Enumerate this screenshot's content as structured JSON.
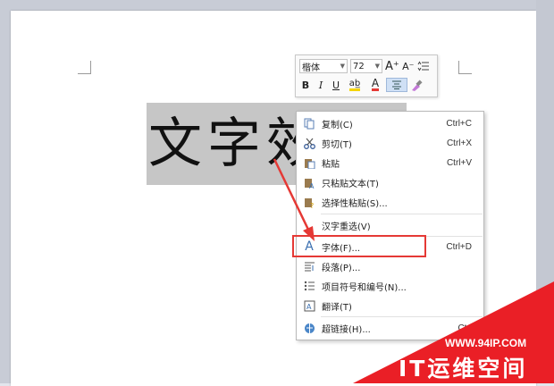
{
  "document": {
    "selected_text": "文字效果"
  },
  "mini_toolbar": {
    "font_name": "楷体",
    "font_size": "72",
    "grow_font": "A⁺",
    "shrink_font": "A⁻",
    "bold": "B",
    "italic": "I",
    "underline": "U",
    "highlight": "ab̲",
    "font_color": "A"
  },
  "context_menu": {
    "items": [
      {
        "label": "复制(C)",
        "shortcut": "Ctrl+C",
        "icon": "copy-icon"
      },
      {
        "label": "剪切(T)",
        "shortcut": "Ctrl+X",
        "icon": "scissors-icon"
      },
      {
        "label": "粘贴",
        "shortcut": "Ctrl+V",
        "icon": "paste-icon"
      },
      {
        "label": "只粘贴文本(T)",
        "shortcut": "",
        "icon": "paste-text-icon"
      },
      {
        "label": "选择性粘贴(S)...",
        "shortcut": "",
        "icon": "paste-special-icon"
      },
      {
        "label": "汉字重选(V)",
        "shortcut": "",
        "icon": ""
      },
      {
        "label": "字体(F)...",
        "shortcut": "Ctrl+D",
        "icon": "font-icon"
      },
      {
        "label": "段落(P)...",
        "shortcut": "",
        "icon": "paragraph-icon"
      },
      {
        "label": "项目符号和编号(N)...",
        "shortcut": "",
        "icon": "bullets-icon"
      },
      {
        "label": "翻译(T)",
        "shortcut": "",
        "icon": "translate-icon"
      },
      {
        "label": "超链接(H)...",
        "shortcut": "Ctrl",
        "icon": "hyperlink-icon"
      }
    ]
  },
  "watermark": {
    "url": "WWW.94IP.COM",
    "brand": "IT运维空间"
  },
  "colors": {
    "highlight_border": "#e53935",
    "watermark": "#ea1f26"
  }
}
